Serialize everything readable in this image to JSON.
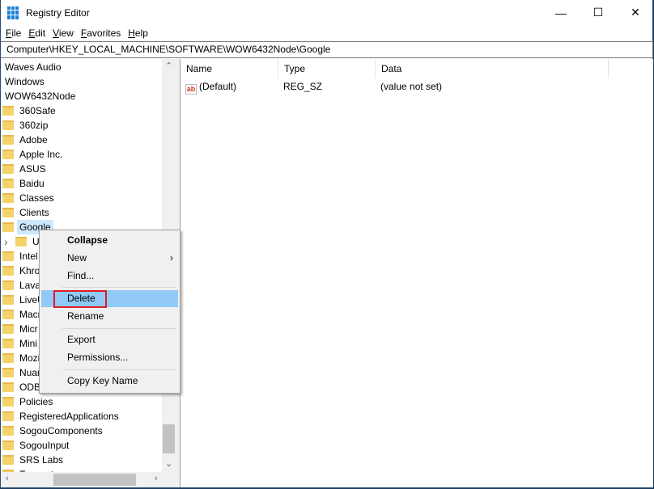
{
  "window": {
    "title": "Registry Editor",
    "minimize": "—",
    "maximize": "☐",
    "close": "✕"
  },
  "menu": [
    "File",
    "Edit",
    "View",
    "Favorites",
    "Help"
  ],
  "address": "Computer\\HKEY_LOCAL_MACHINE\\SOFTWARE\\WOW6432Node\\Google",
  "tree": {
    "top_items": [
      "Waves Audio",
      "Windows",
      "WOW6432Node"
    ],
    "items": [
      "360Safe",
      "360zip",
      "Adobe",
      "Apple Inc.",
      "ASUS",
      "Baidu",
      "Classes",
      "Clients",
      "Google"
    ],
    "child": "U",
    "after": [
      "Intel",
      "Khro",
      "Lava",
      "LiveU",
      "Macr",
      "Micr",
      "Mini",
      "Mozi",
      "Nuar",
      "ODB",
      "Policies",
      "RegisteredApplications",
      "SogouComponents",
      "SogouInput",
      "SRS Labs",
      "Tencent"
    ]
  },
  "columns": [
    "Name",
    "Type",
    "Data"
  ],
  "values": [
    {
      "name": "(Default)",
      "type": "REG_SZ",
      "data": "(value not set)"
    }
  ],
  "context_menu": {
    "collapse": "Collapse",
    "new": "New",
    "find": "Find...",
    "delete": "Delete",
    "rename": "Rename",
    "export": "Export",
    "permissions": "Permissions...",
    "copy": "Copy Key Name"
  },
  "colors": {
    "highlight": "#91c9f7",
    "red_box": "#e01c24"
  }
}
